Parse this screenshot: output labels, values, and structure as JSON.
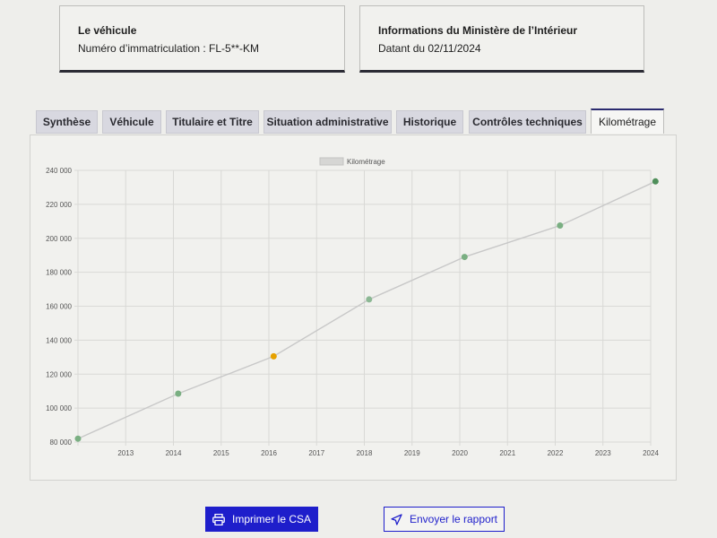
{
  "vehicle": {
    "title": "Le véhicule",
    "plate": "Numéro d’immatriculation : FL-5**-KM"
  },
  "ministry": {
    "title": "Informations du Ministère de l’Intérieur",
    "date": "Datant du 02/11/2024"
  },
  "tabs": [
    {
      "label": "Synthèse",
      "active": false
    },
    {
      "label": "Véhicule",
      "active": false
    },
    {
      "label": "Titulaire et Titre",
      "active": false
    },
    {
      "label": "Situation administrative",
      "active": false
    },
    {
      "label": "Historique",
      "active": false
    },
    {
      "label": "Contrôles techniques",
      "active": false
    },
    {
      "label": "Kilométrage",
      "active": true
    }
  ],
  "chart_data": {
    "type": "line",
    "legend": "Kilométrage",
    "legend_position": "top-center",
    "grid": true,
    "x_ticks": [
      "2013",
      "2014",
      "2015",
      "2016",
      "2017",
      "2018",
      "2019",
      "2020",
      "2021",
      "2022",
      "2023",
      "2024"
    ],
    "y_ticks": [
      "80 000",
      "100 000",
      "120 000",
      "140 000",
      "160 000",
      "180 000",
      "200 000",
      "220 000",
      "240 000"
    ],
    "xlim": [
      2012.0,
      2024.0
    ],
    "ylim": [
      80000,
      240000
    ],
    "series": [
      {
        "name": "Kilométrage",
        "points": [
          {
            "x": 2012.0,
            "y": 82000,
            "color": "#7aaf82"
          },
          {
            "x": 2014.1,
            "y": 108500,
            "color": "#7aaf82"
          },
          {
            "x": 2016.1,
            "y": 130500,
            "color": "#e6a100"
          },
          {
            "x": 2018.1,
            "y": 164000,
            "color": "#8cb894"
          },
          {
            "x": 2020.1,
            "y": 189000,
            "color": "#7aaf82"
          },
          {
            "x": 2022.1,
            "y": 207500,
            "color": "#7aaf82"
          },
          {
            "x": 2024.1,
            "y": 233500,
            "color": "#4f8f5a"
          }
        ]
      }
    ],
    "line_color": "#c8c8c8"
  },
  "actions": {
    "print_label": "Imprimer le CSA",
    "send_label": "Envoyer le rapport"
  },
  "colors": {
    "accent": "#1e1ecb",
    "point_default": "#7aaf82",
    "point_warning": "#e6a100"
  }
}
